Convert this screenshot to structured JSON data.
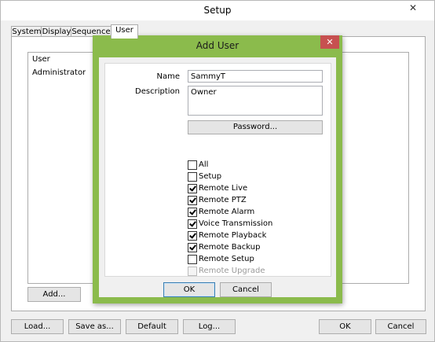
{
  "window": {
    "title": "Setup",
    "close_glyph": "✕"
  },
  "tabs": [
    {
      "label": "System"
    },
    {
      "label": "Display"
    },
    {
      "label": "Sequence"
    },
    {
      "label": "User",
      "active": true
    }
  ],
  "user_list": {
    "header": "User",
    "rows": [
      "Administrator"
    ]
  },
  "panel_buttons": {
    "add": "Add..."
  },
  "footer": {
    "load": "Load...",
    "save_as": "Save as...",
    "default": "Default",
    "log": "Log...",
    "ok": "OK",
    "cancel": "Cancel"
  },
  "dialog": {
    "title": "Add User",
    "close_glyph": "✕",
    "name_label": "Name",
    "name_value": "SammyT",
    "description_label": "Description",
    "description_value": "Owner",
    "password_button": "Password...",
    "permissions": [
      {
        "label": "All",
        "checked": false,
        "disabled": false
      },
      {
        "label": "Setup",
        "checked": false,
        "disabled": false
      },
      {
        "label": "Remote Live",
        "checked": true,
        "disabled": false
      },
      {
        "label": "Remote PTZ",
        "checked": true,
        "disabled": false
      },
      {
        "label": "Remote Alarm",
        "checked": true,
        "disabled": false
      },
      {
        "label": "Voice Transmission",
        "checked": true,
        "disabled": false
      },
      {
        "label": "Remote Playback",
        "checked": true,
        "disabled": false
      },
      {
        "label": "Remote Backup",
        "checked": true,
        "disabled": false
      },
      {
        "label": "Remote Setup",
        "checked": false,
        "disabled": false
      },
      {
        "label": "Remote Upgrade",
        "checked": false,
        "disabled": true
      }
    ],
    "ok": "OK",
    "cancel": "Cancel",
    "accent_color": "#8bbb4c",
    "close_color": "#c75050"
  }
}
